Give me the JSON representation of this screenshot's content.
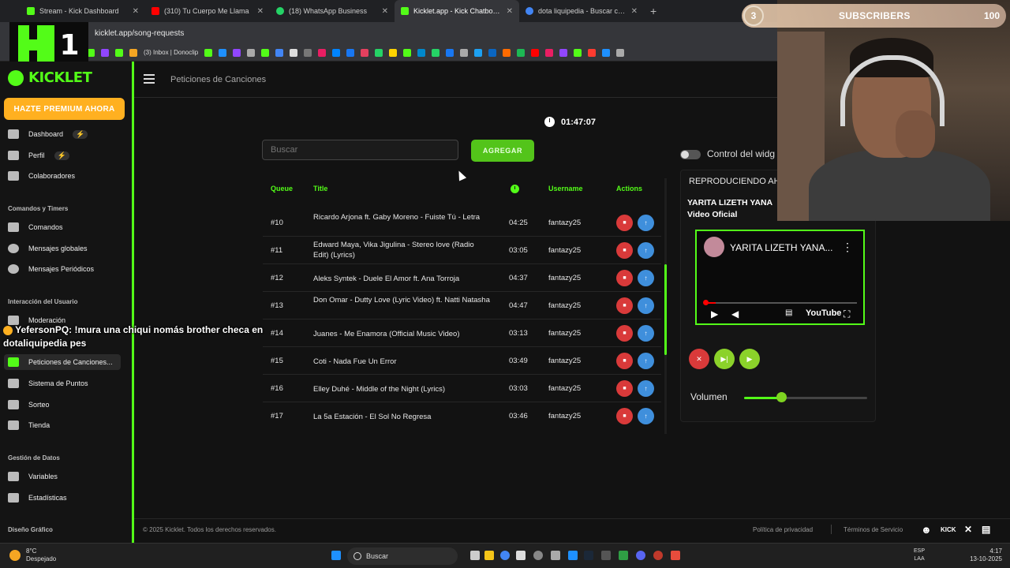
{
  "browser": {
    "tabs": [
      {
        "label": "Stream - Kick Dashboard",
        "color": "#53fc18"
      },
      {
        "label": "(310) Tu Cuerpo Me Llama",
        "color": "#ff0000"
      },
      {
        "label": "(18) WhatsApp Business",
        "color": "#25d366"
      },
      {
        "label": "Kicklet.app - Kick Chatbot and",
        "color": "#53fc18"
      },
      {
        "label": "dota liquipedia - Buscar con G",
        "color": "#4285f4"
      }
    ],
    "address": "kicklet.app/song-requests",
    "bookmark_text": "(3) Inbox | Donoclip"
  },
  "overlay": {
    "k_number": "1",
    "subscribers_count": "3",
    "subscribers_label": "SUBSCRIBERS",
    "subscribers_goal": "100"
  },
  "sidebar": {
    "brand": "KICKLET",
    "premium": "HAZTE PREMIUM AHORA",
    "items_top": [
      {
        "label": "Dashboard",
        "bolt": "⚡"
      },
      {
        "label": "Perfil",
        "bolt": "⚡"
      },
      {
        "label": "Colaboradores"
      }
    ],
    "section_commands": "Comandos y Timers",
    "items_commands": [
      {
        "label": "Comandos"
      },
      {
        "label": "Mensajes globales"
      },
      {
        "label": "Mensajes Periódicos"
      }
    ],
    "section_interaction": "Interacción del Usuario",
    "items_interaction": [
      {
        "label": "Moderación"
      },
      {
        "label": "Peticiones de Canciones..."
      },
      {
        "label": "Sistema de Puntos"
      },
      {
        "label": "Sorteo"
      },
      {
        "label": "Tienda"
      }
    ],
    "section_data": "Gestión de Datos",
    "items_data": [
      {
        "label": "Variables"
      },
      {
        "label": "Estadísticas"
      }
    ],
    "section_design": "Diseño Gráfico"
  },
  "header": {
    "crumb": "Peticiones de Canciones"
  },
  "main": {
    "timer": "01:47:07",
    "search_placeholder": "Buscar",
    "add_button": "AGREGAR",
    "columns": {
      "queue": "Queue",
      "title": "Title",
      "username": "Username",
      "actions": "Actions"
    },
    "rows": [
      {
        "queue": "#10",
        "title": "Ricardo Arjona ft. Gaby Moreno - Fuiste Tú - Letra",
        "duration": "04:25",
        "user": "fantazy25"
      },
      {
        "queue": "#11",
        "title": "Edward Maya, Vika Jigulina - Stereo love (Radio Edit) (Lyrics)",
        "duration": "03:05",
        "user": "fantazy25"
      },
      {
        "queue": "#12",
        "title": "Aleks Syntek - Duele El Amor ft. Ana Torroja",
        "duration": "04:37",
        "user": "fantazy25"
      },
      {
        "queue": "#13",
        "title": "Don Omar - Dutty Love (Lyric Video) ft. Natti Natasha",
        "duration": "04:47",
        "user": "fantazy25"
      },
      {
        "queue": "#14",
        "title": "Juanes - Me Enamora (Official Music Video)",
        "duration": "03:13",
        "user": "fantazy25"
      },
      {
        "queue": "#15",
        "title": "Coti - Nada Fue Un Error",
        "duration": "03:49",
        "user": "fantazy25"
      },
      {
        "queue": "#16",
        "title": "Elley Duhé - Middle of the Night (Lyrics)",
        "duration": "03:03",
        "user": "fantazy25"
      },
      {
        "queue": "#17",
        "title": "La 5a Estación - El Sol No Regresa",
        "duration": "03:46",
        "user": "fantazy25"
      }
    ]
  },
  "player": {
    "toggle_label": "Control del widg",
    "toggle_on": false,
    "now_playing": "REPRODUCIENDO AHO",
    "song_title": "YARITA LIZETH YANA Video Oficial",
    "video_title": "YARITA LIZETH YANA...",
    "video_brand": "YouTube",
    "volume_label": "Volumen",
    "volume_level": 0.3
  },
  "chat": {
    "user": "YefersonPQ:",
    "message": "!mura una chiqui nomás brother checa en dotaliquipedia pes"
  },
  "footer": {
    "copyright": "© 2025 Kicklet. Todos los derechos reservados.",
    "privacy": "Política de privacidad",
    "terms": "Términos de Servicio",
    "kick": "KICK"
  },
  "taskbar": {
    "temp": "8°C",
    "condition": "Despejado",
    "search": "Buscar",
    "lang": "ESP",
    "region": "LAA",
    "time": "4:17",
    "date": "13-10-2025"
  },
  "colors": {
    "accent": "#53fc18",
    "danger": "#d93a3a",
    "info": "#3f8fdc",
    "premium": "#ffb020"
  }
}
